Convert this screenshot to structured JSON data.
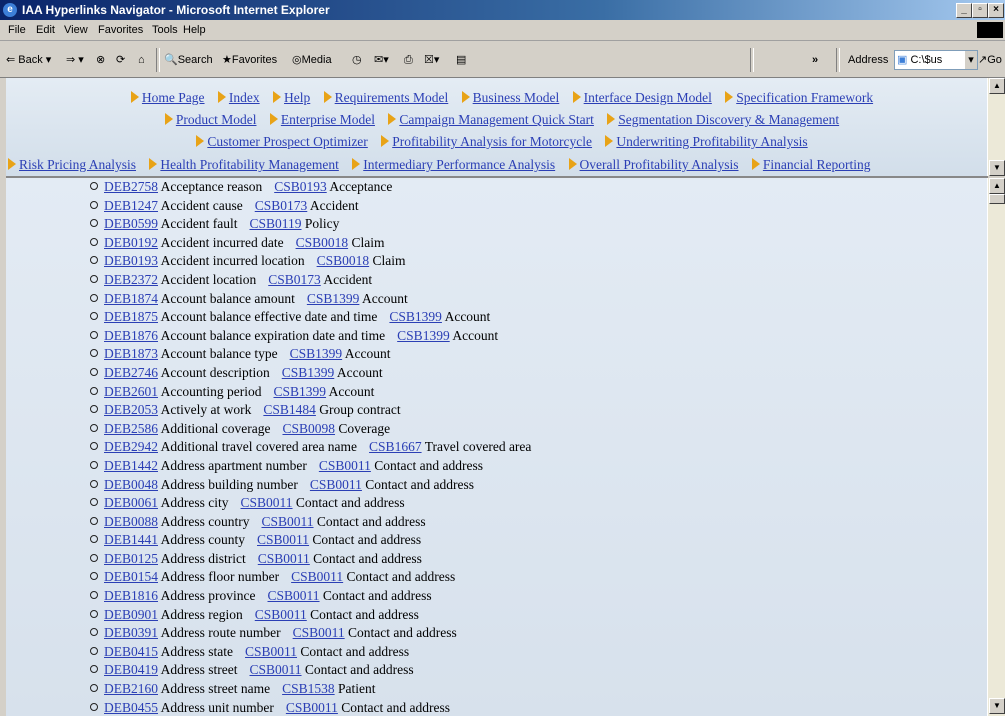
{
  "window": {
    "title": "IAA Hyperlinks Navigator - Microsoft Internet Explorer"
  },
  "menu": [
    "File",
    "Edit",
    "View",
    "Favorites",
    "Tools",
    "Help"
  ],
  "toolbar": {
    "back": "Back",
    "search": "Search",
    "favorites": "Favorites",
    "media": "Media",
    "chevron": "»",
    "address_label": "Address",
    "address_value": "C:\\$us",
    "go": "Go"
  },
  "nav_rows": [
    [
      "Home Page",
      "Index",
      "Help",
      "Requirements Model",
      "Business Model",
      "Interface Design Model",
      "Specification Framework"
    ],
    [
      "Product Model",
      "Enterprise Model",
      "Campaign Management Quick Start",
      "Segmentation Discovery & Management"
    ],
    [
      "Customer Prospect Optimizer",
      "Profitability Analysis for Motorcycle",
      "Underwriting Profitability Analysis"
    ],
    [
      "Risk Pricing Analysis",
      "Health Profitability Management",
      "Intermediary Performance Analysis",
      "Overall Profitability Analysis",
      "Financial Reporting"
    ]
  ],
  "entries": [
    {
      "deb": "DEB2758",
      "name": "Acceptance reason",
      "csb": "CSB0193",
      "entity": "Acceptance"
    },
    {
      "deb": "DEB1247",
      "name": "Accident cause",
      "csb": "CSB0173",
      "entity": "Accident"
    },
    {
      "deb": "DEB0599",
      "name": "Accident fault",
      "csb": "CSB0119",
      "entity": "Policy"
    },
    {
      "deb": "DEB0192",
      "name": "Accident incurred date",
      "csb": "CSB0018",
      "entity": "Claim"
    },
    {
      "deb": "DEB0193",
      "name": "Accident incurred location",
      "csb": "CSB0018",
      "entity": "Claim"
    },
    {
      "deb": "DEB2372",
      "name": "Accident location",
      "csb": "CSB0173",
      "entity": "Accident"
    },
    {
      "deb": "DEB1874",
      "name": "Account balance amount",
      "csb": "CSB1399",
      "entity": "Account"
    },
    {
      "deb": "DEB1875",
      "name": "Account balance effective date and time",
      "csb": "CSB1399",
      "entity": "Account"
    },
    {
      "deb": "DEB1876",
      "name": "Account balance expiration date and time",
      "csb": "CSB1399",
      "entity": "Account"
    },
    {
      "deb": "DEB1873",
      "name": "Account balance type",
      "csb": "CSB1399",
      "entity": "Account"
    },
    {
      "deb": "DEB2746",
      "name": "Account description",
      "csb": "CSB1399",
      "entity": "Account"
    },
    {
      "deb": "DEB2601",
      "name": "Accounting period",
      "csb": "CSB1399",
      "entity": "Account"
    },
    {
      "deb": "DEB2053",
      "name": "Actively at work",
      "csb": "CSB1484",
      "entity": "Group contract"
    },
    {
      "deb": "DEB2586",
      "name": "Additional coverage",
      "csb": "CSB0098",
      "entity": "Coverage"
    },
    {
      "deb": "DEB2942",
      "name": "Additional travel covered area name",
      "csb": "CSB1667",
      "entity": "Travel covered area"
    },
    {
      "deb": "DEB1442",
      "name": "Address apartment number",
      "csb": "CSB0011",
      "entity": "Contact and address"
    },
    {
      "deb": "DEB0048",
      "name": "Address building number",
      "csb": "CSB0011",
      "entity": "Contact and address"
    },
    {
      "deb": "DEB0061",
      "name": "Address city",
      "csb": "CSB0011",
      "entity": "Contact and address"
    },
    {
      "deb": "DEB0088",
      "name": "Address country",
      "csb": "CSB0011",
      "entity": "Contact and address"
    },
    {
      "deb": "DEB1441",
      "name": "Address county",
      "csb": "CSB0011",
      "entity": "Contact and address"
    },
    {
      "deb": "DEB0125",
      "name": "Address district",
      "csb": "CSB0011",
      "entity": "Contact and address"
    },
    {
      "deb": "DEB0154",
      "name": "Address floor number",
      "csb": "CSB0011",
      "entity": "Contact and address"
    },
    {
      "deb": "DEB1816",
      "name": "Address province",
      "csb": "CSB0011",
      "entity": "Contact and address"
    },
    {
      "deb": "DEB0901",
      "name": "Address region",
      "csb": "CSB0011",
      "entity": "Contact and address"
    },
    {
      "deb": "DEB0391",
      "name": "Address route number",
      "csb": "CSB0011",
      "entity": "Contact and address"
    },
    {
      "deb": "DEB0415",
      "name": "Address state",
      "csb": "CSB0011",
      "entity": "Contact and address"
    },
    {
      "deb": "DEB0419",
      "name": "Address street",
      "csb": "CSB0011",
      "entity": "Contact and address"
    },
    {
      "deb": "DEB2160",
      "name": "Address street name",
      "csb": "CSB1538",
      "entity": "Patient"
    },
    {
      "deb": "DEB0455",
      "name": "Address unit number",
      "csb": "CSB0011",
      "entity": "Contact and address"
    }
  ]
}
